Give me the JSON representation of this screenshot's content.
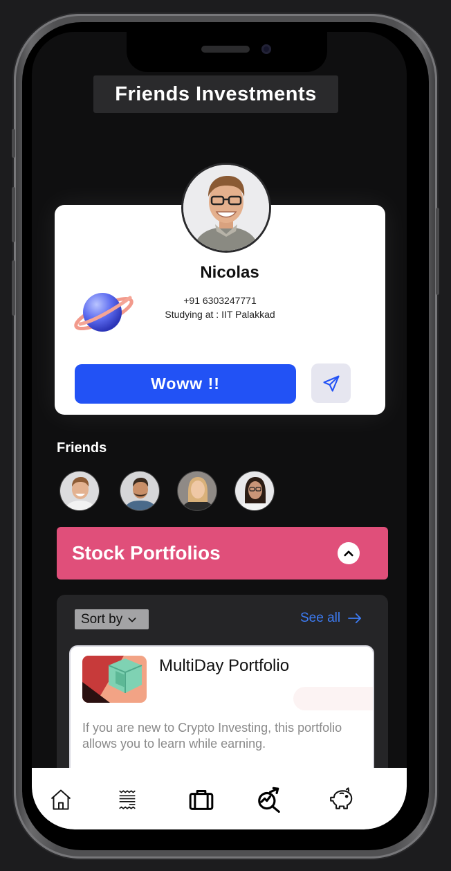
{
  "screen": {
    "title": "Friends Investments"
  },
  "profile": {
    "name": "Nicolas",
    "phone": "+91 6303247771",
    "education": "Studying at : IIT Palakkad",
    "primary_button": "Woww !!"
  },
  "friends": {
    "label": "Friends",
    "count": 4
  },
  "stock_section": {
    "title": "Stock Portfolios",
    "expanded": true
  },
  "portfolio_list": {
    "sort_label": "Sort by",
    "see_all_label": "See all",
    "items": [
      {
        "title": "MultiDay Portfolio",
        "description": "If you are new to Crypto Investing, this portfolio allows you to learn while earning."
      }
    ]
  },
  "tabbar": {
    "items": [
      "home-icon",
      "receipt-icon",
      "briefcase-icon",
      "analytics-icon",
      "piggy-bank-icon"
    ],
    "active": "briefcase-icon"
  },
  "colors": {
    "primary_blue": "#2252f5",
    "accent_pink": "#e04f7a",
    "link_blue": "#3d7cf5",
    "background": "#0f0f10"
  }
}
